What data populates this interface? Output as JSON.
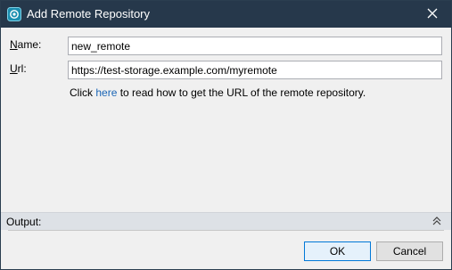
{
  "window": {
    "title": "Add Remote Repository"
  },
  "form": {
    "name_label_mnemonic": "N",
    "name_label_rest": "ame:",
    "name_value": "new_remote",
    "url_label_mnemonic": "U",
    "url_label_rest": "rl:",
    "url_value": "https://test-storage.example.com/myremote",
    "hint_prefix": "Click ",
    "hint_link": "here",
    "hint_suffix": " to read how to get the URL of the remote repository."
  },
  "output": {
    "label": "Output:"
  },
  "buttons": {
    "ok": "OK",
    "cancel": "Cancel"
  },
  "icons": {
    "app": "repository-icon",
    "close": "close-icon",
    "collapse": "double-chevron-up-icon"
  },
  "colors": {
    "titlebar": "#26384b",
    "link": "#1a65b5",
    "ok_border": "#0078d7"
  }
}
